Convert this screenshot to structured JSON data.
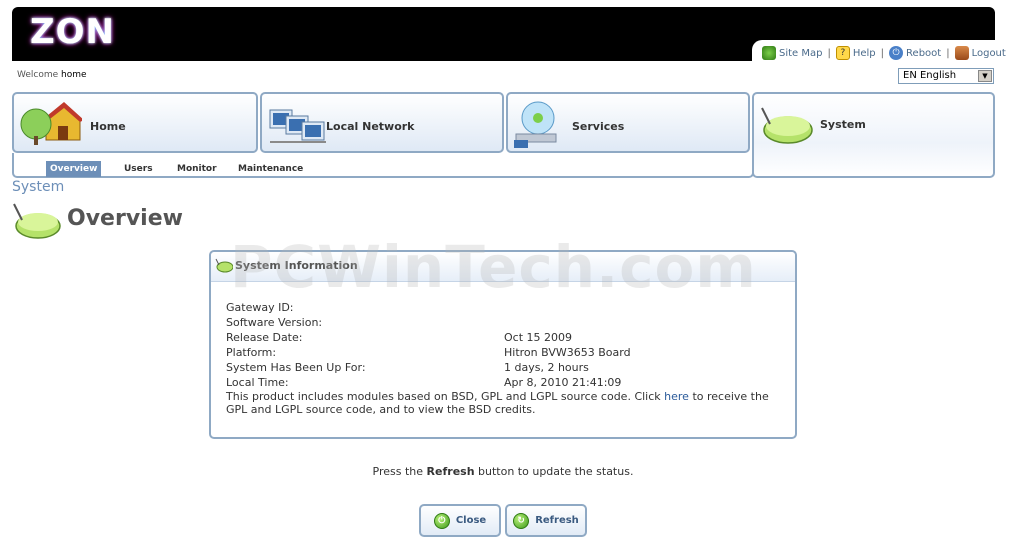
{
  "header": {
    "logo_text": "ZON",
    "toolbar": [
      {
        "label": "Site Map",
        "icon": "sitemap-icon",
        "color": "#3c8a2a"
      },
      {
        "label": "Help",
        "icon": "help-icon",
        "color": "#e0b000"
      },
      {
        "label": "Reboot",
        "icon": "power-icon",
        "color": "#3a6fb0"
      },
      {
        "label": "Logout",
        "icon": "logout-icon",
        "color": "#b06a2a"
      }
    ],
    "welcome_prefix": "Welcome",
    "welcome_user": "home",
    "language": "EN English"
  },
  "nav": {
    "tabs": [
      {
        "label": "Home"
      },
      {
        "label": "Local Network"
      },
      {
        "label": "Services"
      },
      {
        "label": "System"
      }
    ],
    "subtabs": [
      {
        "label": "Overview"
      },
      {
        "label": "Users"
      },
      {
        "label": "Monitor"
      },
      {
        "label": "Maintenance"
      }
    ]
  },
  "page": {
    "section": "System",
    "title": "Overview"
  },
  "panel": {
    "title": "System Information",
    "rows": [
      {
        "label": "Gateway ID:",
        "value": ""
      },
      {
        "label": "Software Version:",
        "value": ""
      },
      {
        "label": "Release Date:",
        "value": "Oct 15 2009"
      },
      {
        "label": "Platform:",
        "value": "Hitron BVW3653 Board"
      },
      {
        "label": "System Has Been Up For:",
        "value": "1 days, 2 hours"
      },
      {
        "label": "Local Time:",
        "value": "Apr 8, 2010 21:41:09"
      }
    ],
    "note_before": "This product includes modules based on BSD, GPL and LGPL source code. Click ",
    "note_link": "here",
    "note_after": " to receive the GPL and LGPL source code, and to view the BSD credits."
  },
  "watermark": "PCWinTech.com",
  "status": {
    "before": "Press the ",
    "bold": "Refresh",
    "after": " button to update the status."
  },
  "buttons": {
    "close": "Close",
    "refresh": "Refresh"
  },
  "colors": {
    "accent": "#6d8fb8",
    "border": "#8fa9c4"
  }
}
